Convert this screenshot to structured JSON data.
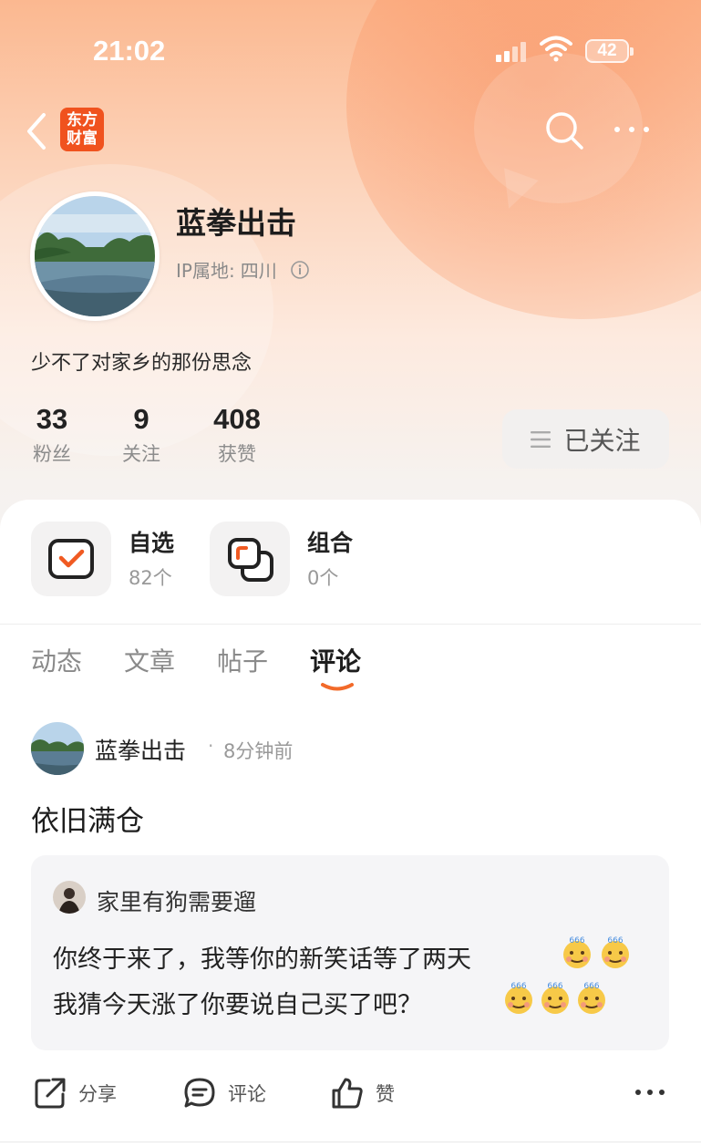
{
  "status_bar": {
    "time": "21:02",
    "battery": "42"
  },
  "nav": {
    "logo_line1": "东方",
    "logo_line2": "财富"
  },
  "profile": {
    "nickname": "蓝拳出击",
    "ip_label": "IP属地:",
    "ip_location": "四川",
    "bio": "少不了对家乡的那份思念",
    "stats": [
      {
        "value": "33",
        "label": "粉丝"
      },
      {
        "value": "9",
        "label": "关注"
      },
      {
        "value": "408",
        "label": "获赞"
      }
    ],
    "follow_label": "已关注"
  },
  "quick": {
    "watchlist": {
      "title": "自选",
      "count": "82个"
    },
    "portfolio": {
      "title": "组合",
      "count": "0个"
    }
  },
  "tabs": [
    "动态",
    "文章",
    "帖子",
    "评论"
  ],
  "active_tab": "评论",
  "post": {
    "author": "蓝拳出击",
    "dot": "·",
    "time": "8分钟前",
    "content": "依旧满仓",
    "quote": {
      "author": "家里有狗需要遛",
      "line1": "你终于来了，我等你的新笑话等了两天",
      "line2": "我猜今天涨了你要说自己买了吧？"
    },
    "actions": {
      "share": "分享",
      "comment": "评论",
      "like": "赞"
    }
  },
  "colors": {
    "brand": "#f0521e",
    "accent": "#f26a2a"
  }
}
